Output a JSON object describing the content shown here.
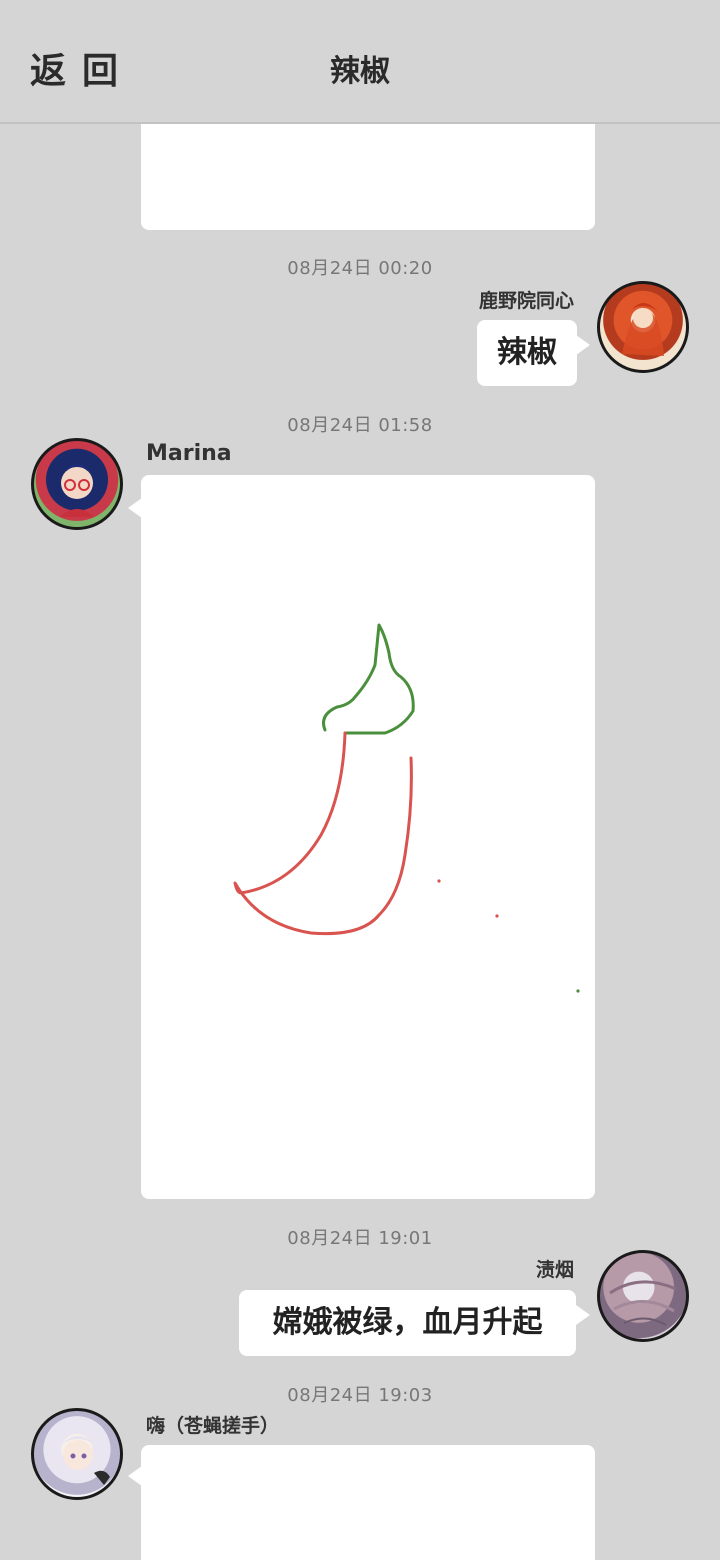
{
  "header": {
    "back_label": "返回",
    "title": "辣椒"
  },
  "messages": [
    {
      "timestamp": "08月24日 00:20",
      "sender": "鹿野院同心",
      "text": "辣椒",
      "side": "right",
      "avatar": "avatar-red-hair"
    },
    {
      "timestamp": "08月24日 01:58",
      "sender": "Marina",
      "type": "drawing",
      "drawing": "chili-pepper-sketch",
      "side": "left",
      "avatar": "avatar-blue-hair-glasses"
    },
    {
      "timestamp": "08月24日 19:01",
      "sender": "渍烟",
      "text": "嫦娥被绿，血月升起",
      "side": "right",
      "avatar": "avatar-muted-sketch"
    },
    {
      "timestamp": "08月24日 19:03",
      "sender": "嗨（苍蝇搓手）",
      "type": "drawing",
      "side": "left",
      "avatar": "avatar-white-hair"
    }
  ],
  "colors": {
    "background": "#d5d5d5",
    "bubble": "#ffffff",
    "drawing_red": "#d9534f",
    "drawing_green": "#4a8f3c"
  }
}
